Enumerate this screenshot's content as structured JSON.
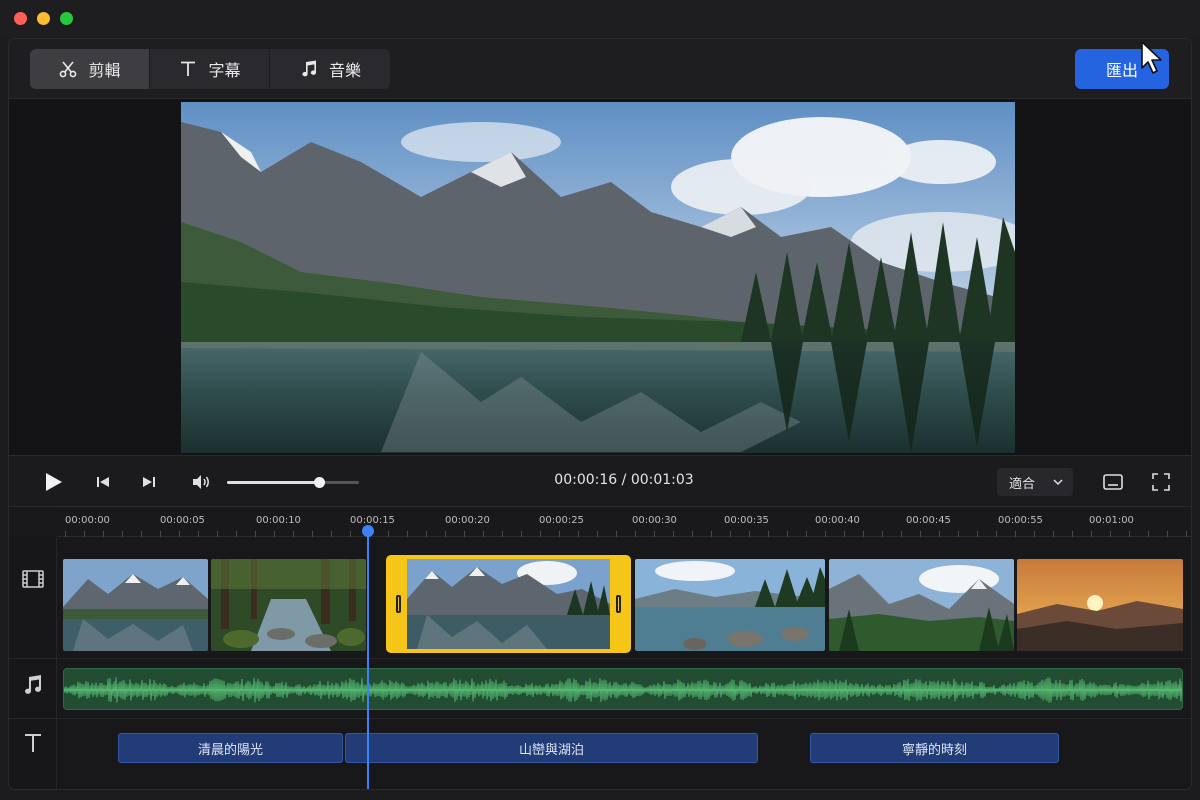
{
  "toolbar": {
    "tabs": [
      {
        "label": "剪輯",
        "icon": "scissors-icon",
        "active": true
      },
      {
        "label": "字幕",
        "icon": "text-icon",
        "active": false
      },
      {
        "label": "音樂",
        "icon": "music-note-icon",
        "active": false
      }
    ],
    "export_label": "匯出"
  },
  "controls": {
    "current_time": "00:00:16",
    "separator": "/",
    "total_time": "00:01:03",
    "volume": 0.7,
    "fit_label": "適合"
  },
  "timeline": {
    "ruler": [
      "00:00:00",
      "00:00:05",
      "00:00:10",
      "00:00:15",
      "00:00:20",
      "00:00:25",
      "00:00:30",
      "00:00:35",
      "00:00:40",
      "00:00:45",
      "00:00:55",
      "00:01:00"
    ],
    "playhead_time": "00:00:16",
    "subtitles": [
      {
        "text": "清晨的陽光"
      },
      {
        "text": "山巒與湖泊"
      },
      {
        "text": "寧靜的時刻"
      }
    ]
  },
  "colors": {
    "accent": "#2563e0",
    "selection": "#f5c517",
    "playhead": "#3b82f6",
    "audio": "#234d33",
    "subtitle": "#223c78"
  }
}
